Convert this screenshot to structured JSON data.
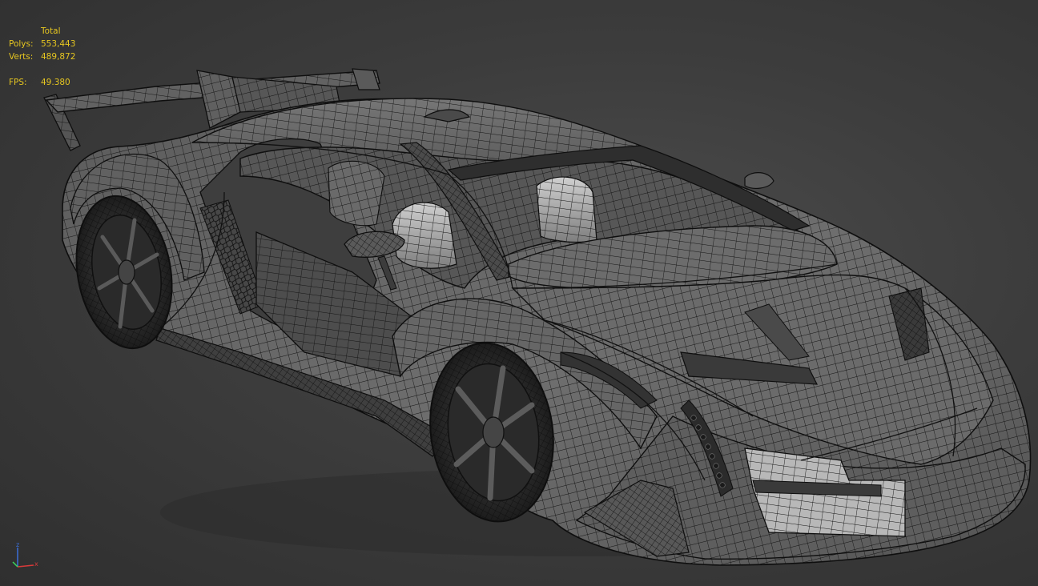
{
  "viewport": {
    "background": "#3a3a3a",
    "wireframe_color": "#0e0e0e",
    "shade_color": "#707070",
    "highlight_color": "#d0d0d0"
  },
  "stats": {
    "header": "Total",
    "polys_label": "Polys:",
    "polys_value": "553,443",
    "verts_label": "Verts:",
    "verts_value": "489,872",
    "fps_label": "FPS:",
    "fps_value": "49.380",
    "color": "#e6c620"
  },
  "axis_gizmo": {
    "z_label": "z",
    "x_label": "x",
    "z_color": "#3a6fd8",
    "x_color": "#d83a3a",
    "y_color": "#3ad85a"
  }
}
